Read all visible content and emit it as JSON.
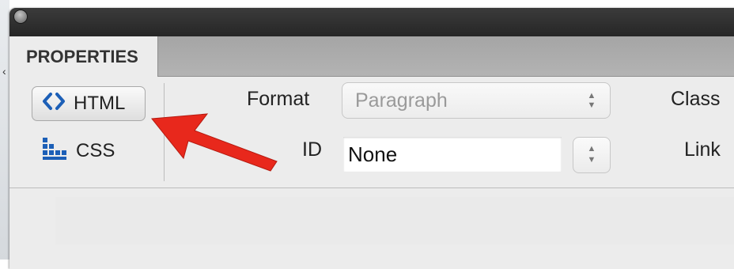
{
  "panel": {
    "tab_label": "PROPERTIES"
  },
  "mode_buttons": {
    "html_label": "HTML",
    "css_label": "CSS"
  },
  "fields": {
    "format_label": "Format",
    "format_value": "Paragraph",
    "id_label": "ID",
    "id_value": "None",
    "class_label": "Class",
    "link_label": "Link"
  },
  "icons": {
    "html": "code-brackets-icon",
    "css": "css-rules-icon",
    "stepper": "up-down-arrows-icon",
    "annotation": "red-pointer-arrow"
  },
  "colors": {
    "titlebar": "#2e2e2e",
    "tab_active": "#ececec",
    "tabstrip": "#acacac",
    "annotation_arrow": "#e8281c",
    "icon_blue": "#1c5fb7"
  }
}
